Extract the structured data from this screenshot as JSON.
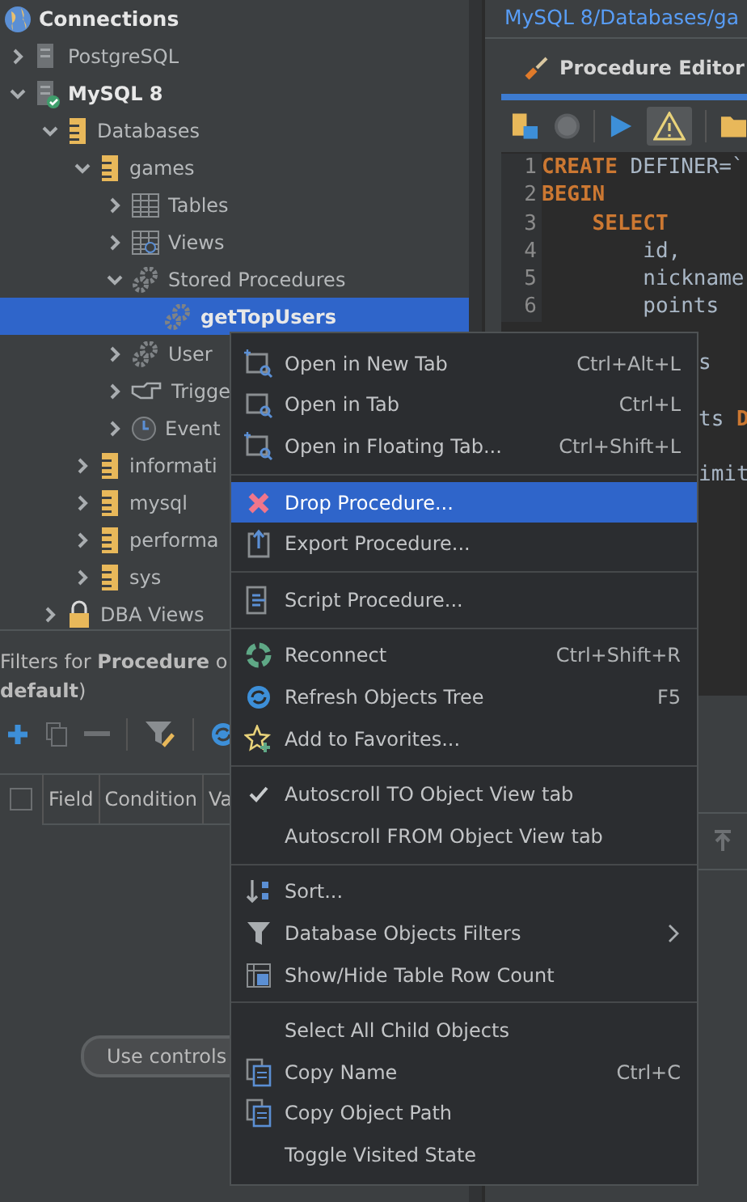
{
  "navigator": {
    "title": "Connections",
    "tree": [
      {
        "label": "PostgreSQL",
        "kind": "connection",
        "connected": false,
        "expanded": false,
        "selected": false
      },
      {
        "label": "MySQL 8",
        "kind": "connection",
        "connected": true,
        "expanded": true,
        "selected": false,
        "children": [
          {
            "label": "Databases",
            "kind": "folder",
            "expanded": true,
            "selected": false,
            "children": [
              {
                "label": "games",
                "kind": "database",
                "expanded": true,
                "selected": false,
                "children": [
                  {
                    "label": "Tables",
                    "kind": "tables",
                    "expanded": false,
                    "selected": false
                  },
                  {
                    "label": "Views",
                    "kind": "views",
                    "expanded": false,
                    "selected": false
                  },
                  {
                    "label": "Stored Procedures",
                    "kind": "procedures",
                    "expanded": true,
                    "selected": false,
                    "children": [
                      {
                        "label": "getTopUsers",
                        "kind": "procedure",
                        "selected": true
                      }
                    ]
                  },
                  {
                    "label": "User",
                    "kind": "functions",
                    "expanded": false,
                    "selected": false
                  },
                  {
                    "label": "Trigge",
                    "kind": "triggers",
                    "expanded": false,
                    "selected": false
                  },
                  {
                    "label": "Event",
                    "kind": "events",
                    "expanded": false,
                    "selected": false
                  }
                ]
              },
              {
                "label": "informati",
                "kind": "database",
                "expanded": false,
                "selected": false
              },
              {
                "label": "mysql",
                "kind": "database",
                "expanded": false,
                "selected": false
              },
              {
                "label": "performa",
                "kind": "database",
                "expanded": false,
                "selected": false
              },
              {
                "label": "sys",
                "kind": "database",
                "expanded": false,
                "selected": false
              }
            ]
          },
          {
            "label": "DBA Views",
            "kind": "dba",
            "expanded": false,
            "selected": false
          }
        ]
      }
    ]
  },
  "filters": {
    "heading_lines": [
      "Filters for **Procedure** o",
      "**default**)"
    ],
    "columns": [
      "Field",
      "Condition",
      "Va"
    ],
    "select_all_checked": false,
    "button": "Use controls"
  },
  "editor": {
    "breadcrumb": "MySQL 8/Databases/ga",
    "tab": "Procedure Editor",
    "code_lines": [
      {
        "number": "1",
        "tokens": [
          {
            "text": "CREATE",
            "kind": "keyword"
          },
          {
            "text": " DEFINER=`",
            "kind": "plain"
          }
        ]
      },
      {
        "number": "2",
        "tokens": [
          {
            "text": "BEGIN",
            "kind": "keyword"
          }
        ]
      },
      {
        "number": "3",
        "tokens": [
          {
            "text": "    SELECT",
            "kind": "keyword"
          }
        ]
      },
      {
        "number": "4",
        "tokens": [
          {
            "text": "        id,",
            "kind": "plain"
          }
        ]
      },
      {
        "number": "5",
        "tokens": [
          {
            "text": "        nickname",
            "kind": "plain"
          }
        ]
      },
      {
        "number": "6",
        "tokens": [
          {
            "text": "        points",
            "kind": "plain"
          }
        ]
      }
    ],
    "code_fragments": [
      {
        "tokens": [
          {
            "text": "s",
            "kind": "plain"
          }
        ]
      },
      {
        "tokens": [
          {
            "text": "ts ",
            "kind": "plain"
          },
          {
            "text": "D",
            "kind": "keyword"
          }
        ]
      },
      {
        "tokens": [
          {
            "text": "imit",
            "kind": "plain"
          }
        ]
      }
    ]
  },
  "context_menu": {
    "groups": [
      [
        {
          "label": "Open in New Tab",
          "shortcut": "Ctrl+Alt+L",
          "selected": false,
          "checked": false
        },
        {
          "label": "Open in Tab",
          "shortcut": "Ctrl+L",
          "selected": false,
          "checked": false
        },
        {
          "label": "Open in Floating Tab...",
          "shortcut": "Ctrl+Shift+L",
          "selected": false,
          "checked": false
        }
      ],
      [
        {
          "label": "Drop Procedure...",
          "selected": true,
          "checked": false
        },
        {
          "label": "Export Procedure...",
          "selected": false,
          "checked": false
        }
      ],
      [
        {
          "label": "Script Procedure...",
          "selected": false,
          "checked": false
        }
      ],
      [
        {
          "label": "Reconnect",
          "shortcut": "Ctrl+Shift+R",
          "selected": false,
          "checked": false
        },
        {
          "label": "Refresh Objects Tree",
          "shortcut": "F5",
          "selected": false,
          "checked": false
        },
        {
          "label": "Add to Favorites...",
          "selected": false,
          "checked": false
        }
      ],
      [
        {
          "label": "Autoscroll TO Object View tab",
          "selected": false,
          "checked": true
        },
        {
          "label": "Autoscroll FROM Object View tab",
          "selected": false,
          "checked": false
        }
      ],
      [
        {
          "label": "Sort...",
          "selected": false,
          "checked": false
        },
        {
          "label": "Database Objects Filters",
          "submenu": true,
          "selected": false,
          "checked": false
        },
        {
          "label": "Show/Hide Table Row Count",
          "selected": false,
          "checked": false
        }
      ],
      [
        {
          "label": "Select All Child Objects",
          "selected": false,
          "checked": false
        },
        {
          "label": "Copy Name",
          "shortcut": "Ctrl+C",
          "selected": false,
          "checked": false
        },
        {
          "label": "Copy Object Path",
          "selected": false,
          "checked": false
        },
        {
          "label": "Toggle Visited State",
          "selected": false,
          "checked": false
        }
      ]
    ]
  }
}
